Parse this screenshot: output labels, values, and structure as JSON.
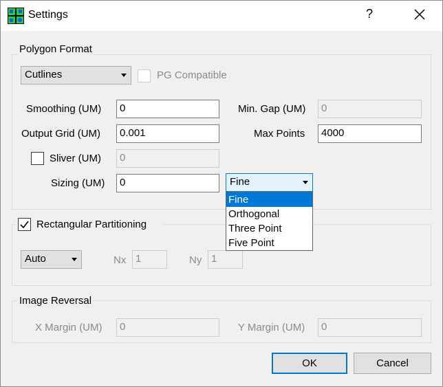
{
  "window": {
    "title": "Settings",
    "help_glyph": "?",
    "close_icon": "close-icon"
  },
  "polygon_format": {
    "group_label": "Polygon Format",
    "format_select": {
      "value": "Cutlines",
      "options_visible": [
        "Cutlines"
      ]
    },
    "pg_compatible": {
      "label": "PG Compatible",
      "checked": false,
      "enabled": false
    },
    "smoothing": {
      "label": "Smoothing (UM)",
      "value": "0"
    },
    "min_gap": {
      "label": "Min. Gap (UM)",
      "value": "0",
      "enabled": false
    },
    "output_grid": {
      "label": "Output Grid (UM)",
      "value": "0.001"
    },
    "max_points": {
      "label": "Max Points",
      "value": "4000"
    },
    "sliver": {
      "label": "Sliver (UM)",
      "checked": false,
      "value": "0",
      "enabled": false
    },
    "sizing": {
      "label": "Sizing (UM)",
      "value": "0",
      "mode_select": {
        "value": "Fine",
        "open": true,
        "options": [
          "Fine",
          "Orthogonal",
          "Three Point",
          "Five Point"
        ],
        "highlighted": "Fine"
      }
    }
  },
  "rectangular_partitioning": {
    "label": "Rectangular Partitioning",
    "checked": true,
    "mode_select": {
      "value": "Auto"
    },
    "nx": {
      "label": "Nx",
      "value": "1",
      "enabled": false
    },
    "ny": {
      "label": "Ny",
      "value": "1",
      "enabled": false
    }
  },
  "image_reversal": {
    "group_label": "Image Reversal",
    "x_margin": {
      "label": "X Margin (UM)",
      "value": "0",
      "enabled": false
    },
    "y_margin": {
      "label": "Y Margin (UM)",
      "value": "0",
      "enabled": false
    }
  },
  "buttons": {
    "ok": "OK",
    "cancel": "Cancel"
  },
  "colors": {
    "accent": "#0078d7",
    "dialog_bg": "#f0f0f0",
    "disabled_text": "#8a8a8a"
  }
}
